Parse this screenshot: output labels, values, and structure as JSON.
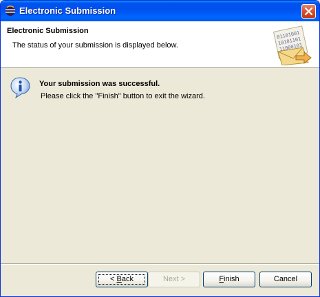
{
  "window": {
    "title": "Electronic Submission",
    "icon": "eclipse-icon"
  },
  "header": {
    "title": "Electronic Submission",
    "description": "The status of your submission is displayed below.",
    "banner_icon": "binary-envelope-icon",
    "banner_lines": [
      "01101001",
      "10101101",
      "11000101"
    ]
  },
  "message": {
    "icon": "info-icon",
    "title": "Your submission was successful.",
    "body": "Please click the \"Finish\" button to exit the wizard."
  },
  "buttons": {
    "back": {
      "mnemonic": "< ",
      "underlined": "B",
      "rest": "ack",
      "enabled": true
    },
    "next": {
      "label": "Next >",
      "enabled": false
    },
    "finish": {
      "underlined": "F",
      "rest": "inish",
      "enabled": true
    },
    "cancel": {
      "label": "Cancel",
      "enabled": true
    }
  },
  "colors": {
    "title_bar": "#0054e3",
    "dialog_bg": "#ece9d8",
    "header_bg": "#ffffff"
  }
}
